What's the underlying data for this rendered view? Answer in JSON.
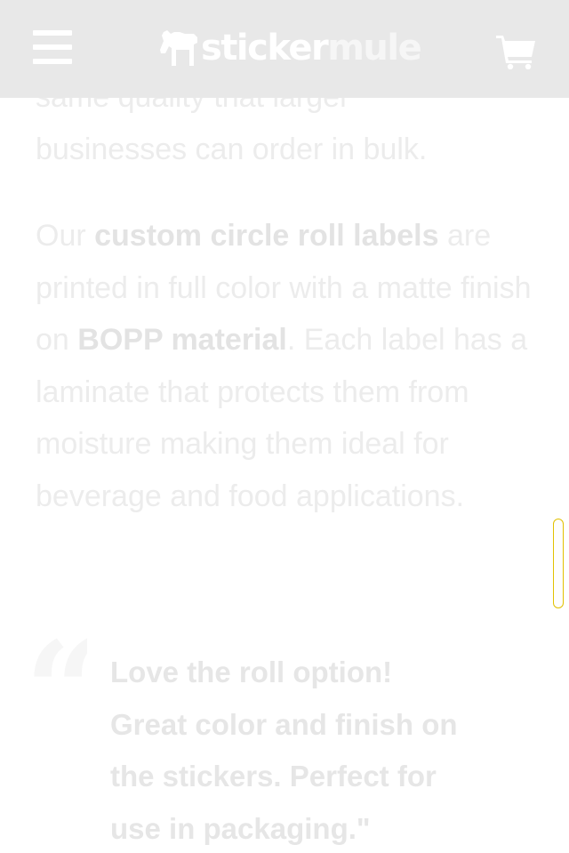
{
  "header": {
    "logo_part1": "sticker",
    "logo_part2": "mule"
  },
  "icons": {
    "menu": "hamburger-menu-icon",
    "logo": "mule-icon",
    "cart": "shopping-cart-icon",
    "quote": "quote-mark-icon"
  },
  "colors": {
    "header_bg": "#e8e8e8",
    "body_text": "#ececec",
    "scrollbar_border": "#e2c100"
  },
  "content": {
    "para1_line1": "same quality that larger",
    "para1_line2": "businesses can order in bulk.",
    "para2_pre": "Our ",
    "para2_bold1": "custom circle roll labels",
    "para2_mid1": " are printed in full color with a matte finish on ",
    "para2_bold2": "BOPP material",
    "para2_post": ". Each label has a laminate that protects them from moisture making them ideal for beverage and food applications.",
    "quote_mark": "“",
    "quote": "Love the roll option! Great color and finish on the stickers. Perfect for use in packaging.\""
  }
}
